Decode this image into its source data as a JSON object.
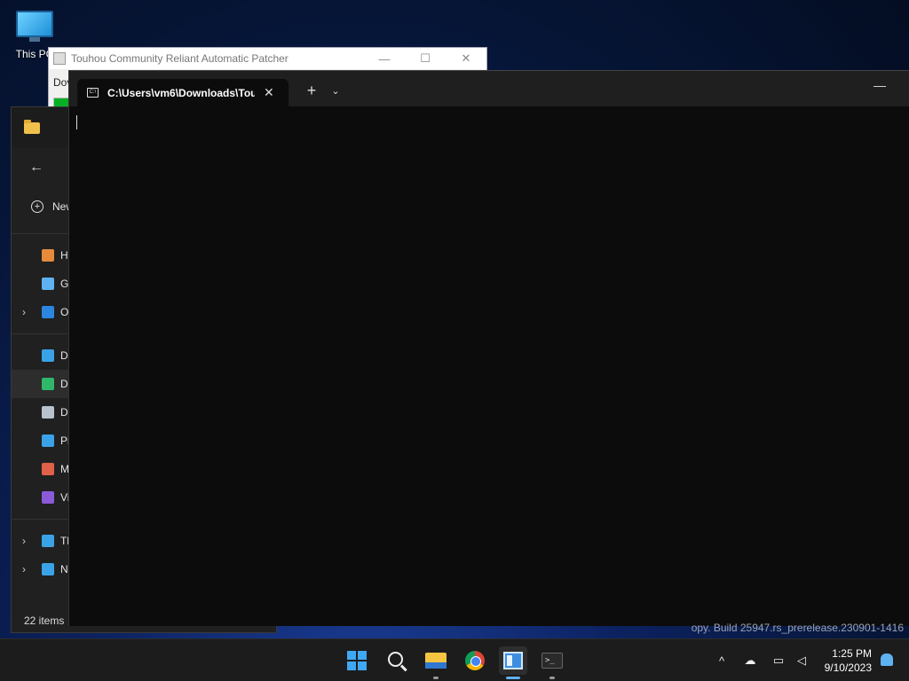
{
  "desktop": {
    "icon_label": "This PC"
  },
  "patcher": {
    "title": "Touhou Community Reliant Automatic Patcher",
    "body_label": "Dov",
    "progress": 0.04,
    "controls": {
      "minimize": "—",
      "maximize": "☐",
      "close": "✕"
    }
  },
  "explorer": {
    "new_label": "New",
    "back_icon": "←",
    "items": [
      {
        "label": "H",
        "icon": "home-icon",
        "color": "#e58b3a"
      },
      {
        "label": "G",
        "icon": "gallery-icon",
        "color": "#5fb2f2"
      },
      {
        "label": "O",
        "icon": "onedrive-icon",
        "color": "#2c86e0",
        "chevron": "›"
      },
      {
        "label": "D",
        "icon": "desktop-icon",
        "color": "#3aa3e8"
      },
      {
        "label": "D",
        "icon": "downloads-icon",
        "color": "#2fb86a",
        "selected": true
      },
      {
        "label": "D",
        "icon": "documents-icon",
        "color": "#b8c2cc"
      },
      {
        "label": "Pi",
        "icon": "pictures-icon",
        "color": "#3aa3e8"
      },
      {
        "label": "M",
        "icon": "music-icon",
        "color": "#e0604a"
      },
      {
        "label": "Vi",
        "icon": "videos-icon",
        "color": "#8a5ad8"
      },
      {
        "label": "Tl",
        "icon": "this-pc-icon",
        "color": "#3aa3e8",
        "chevron": "›"
      },
      {
        "label": "N",
        "icon": "network-icon",
        "color": "#3aa3e8",
        "chevron": "›"
      }
    ],
    "status": "22 items"
  },
  "terminal": {
    "tab_title": "C:\\Users\\vm6\\Downloads\\Tou",
    "tab_close": "✕",
    "new_tab": "+",
    "dropdown": "⌄",
    "minimize": "—",
    "cmd_icon_text": "C:\\"
  },
  "watermark": "opy. Build 25947.rs_prerelease.230901-1416",
  "taskbar": {
    "apps": [
      "start-icon",
      "search-icon",
      "file-explorer-icon",
      "chrome-icon",
      "notepad-icon",
      "terminal-icon"
    ],
    "tray": {
      "chevron": "^",
      "time": "1:25 PM",
      "date": "9/10/2023"
    }
  }
}
